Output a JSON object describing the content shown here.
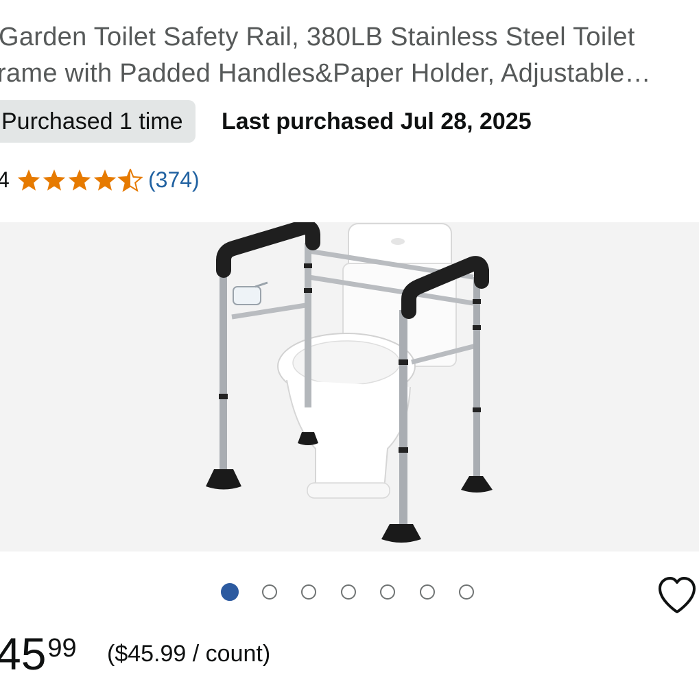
{
  "product": {
    "title_line1": "Garden Toilet Safety Rail, 380LB Stainless Steel Toilet",
    "title_line2": "rame with Padded Handles&Paper Holder, Adjustable…"
  },
  "purchase": {
    "badge": "Purchased 1 time",
    "last_purchased": "Last purchased Jul 28, 2025"
  },
  "rating": {
    "value_fragment": "4",
    "stars": 4.5,
    "review_count": "(374)",
    "star_color": "#e67a00"
  },
  "image": {
    "alt_subject": "toilet-safety-rail-product-image"
  },
  "carousel": {
    "total": 7,
    "active_index": 0,
    "active_color": "#2c5aa0"
  },
  "wishlist": {
    "icon": "heart-icon"
  },
  "price": {
    "whole": "45",
    "fraction": "99",
    "unit_price": "($45.99 / count)"
  }
}
